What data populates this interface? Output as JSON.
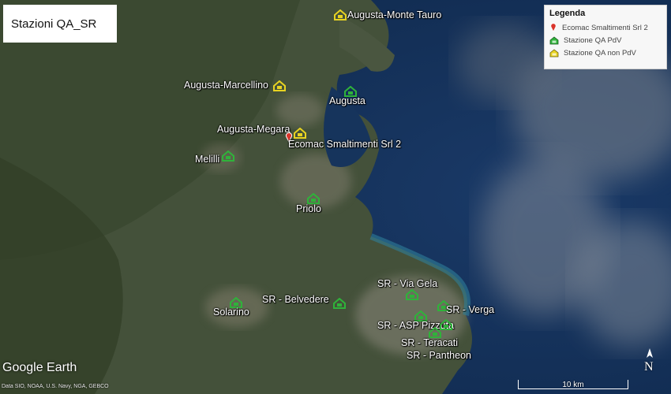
{
  "title": "Stazioni QA_SR",
  "legend": {
    "title": "Legenda",
    "items": [
      {
        "label": "Ecomac Smaltimenti Srl 2",
        "icon": "red-pin-icon",
        "color": "#d9342b"
      },
      {
        "label": "Stazione QA PdV",
        "icon": "green-house-icon",
        "color": "#2fb33a"
      },
      {
        "label": "Stazione QA non PdV",
        "icon": "yellow-house-icon",
        "color": "#e8d321"
      }
    ]
  },
  "stations": [
    {
      "label": "Augusta-Monte Tauro",
      "type": "non_pdv"
    },
    {
      "label": "Augusta-Marcellino",
      "type": "non_pdv"
    },
    {
      "label": "Augusta",
      "type": "pdv"
    },
    {
      "label": "Augusta-Megara",
      "type": "non_pdv"
    },
    {
      "label": "Melilli",
      "type": "pdv"
    },
    {
      "label": "Priolo",
      "type": "pdv"
    },
    {
      "label": "Solarino",
      "type": "pdv"
    },
    {
      "label": "SR - Belvedere",
      "type": "pdv"
    },
    {
      "label": "SR - Via Gela",
      "type": "pdv"
    },
    {
      "label": "SR - Verga",
      "type": "pdv"
    },
    {
      "label": "SR - ASP Pizzuta",
      "type": "pdv"
    },
    {
      "label": "SR - Teracati",
      "type": "pdv"
    },
    {
      "label": "SR - Pantheon",
      "type": "pdv"
    }
  ],
  "site": {
    "label": "Ecomac Smaltimenti Srl 2"
  },
  "logo": "Google Earth",
  "credits": "Data SIO, NOAA, U.S. Navy, NGA, GEBCO",
  "scale": "10 km",
  "north": "N",
  "colors": {
    "land": "#3f4b33",
    "sea": "#1e3f66",
    "pdv": "#2fb33a",
    "non_pdv": "#e8d321",
    "site": "#d9342b"
  }
}
